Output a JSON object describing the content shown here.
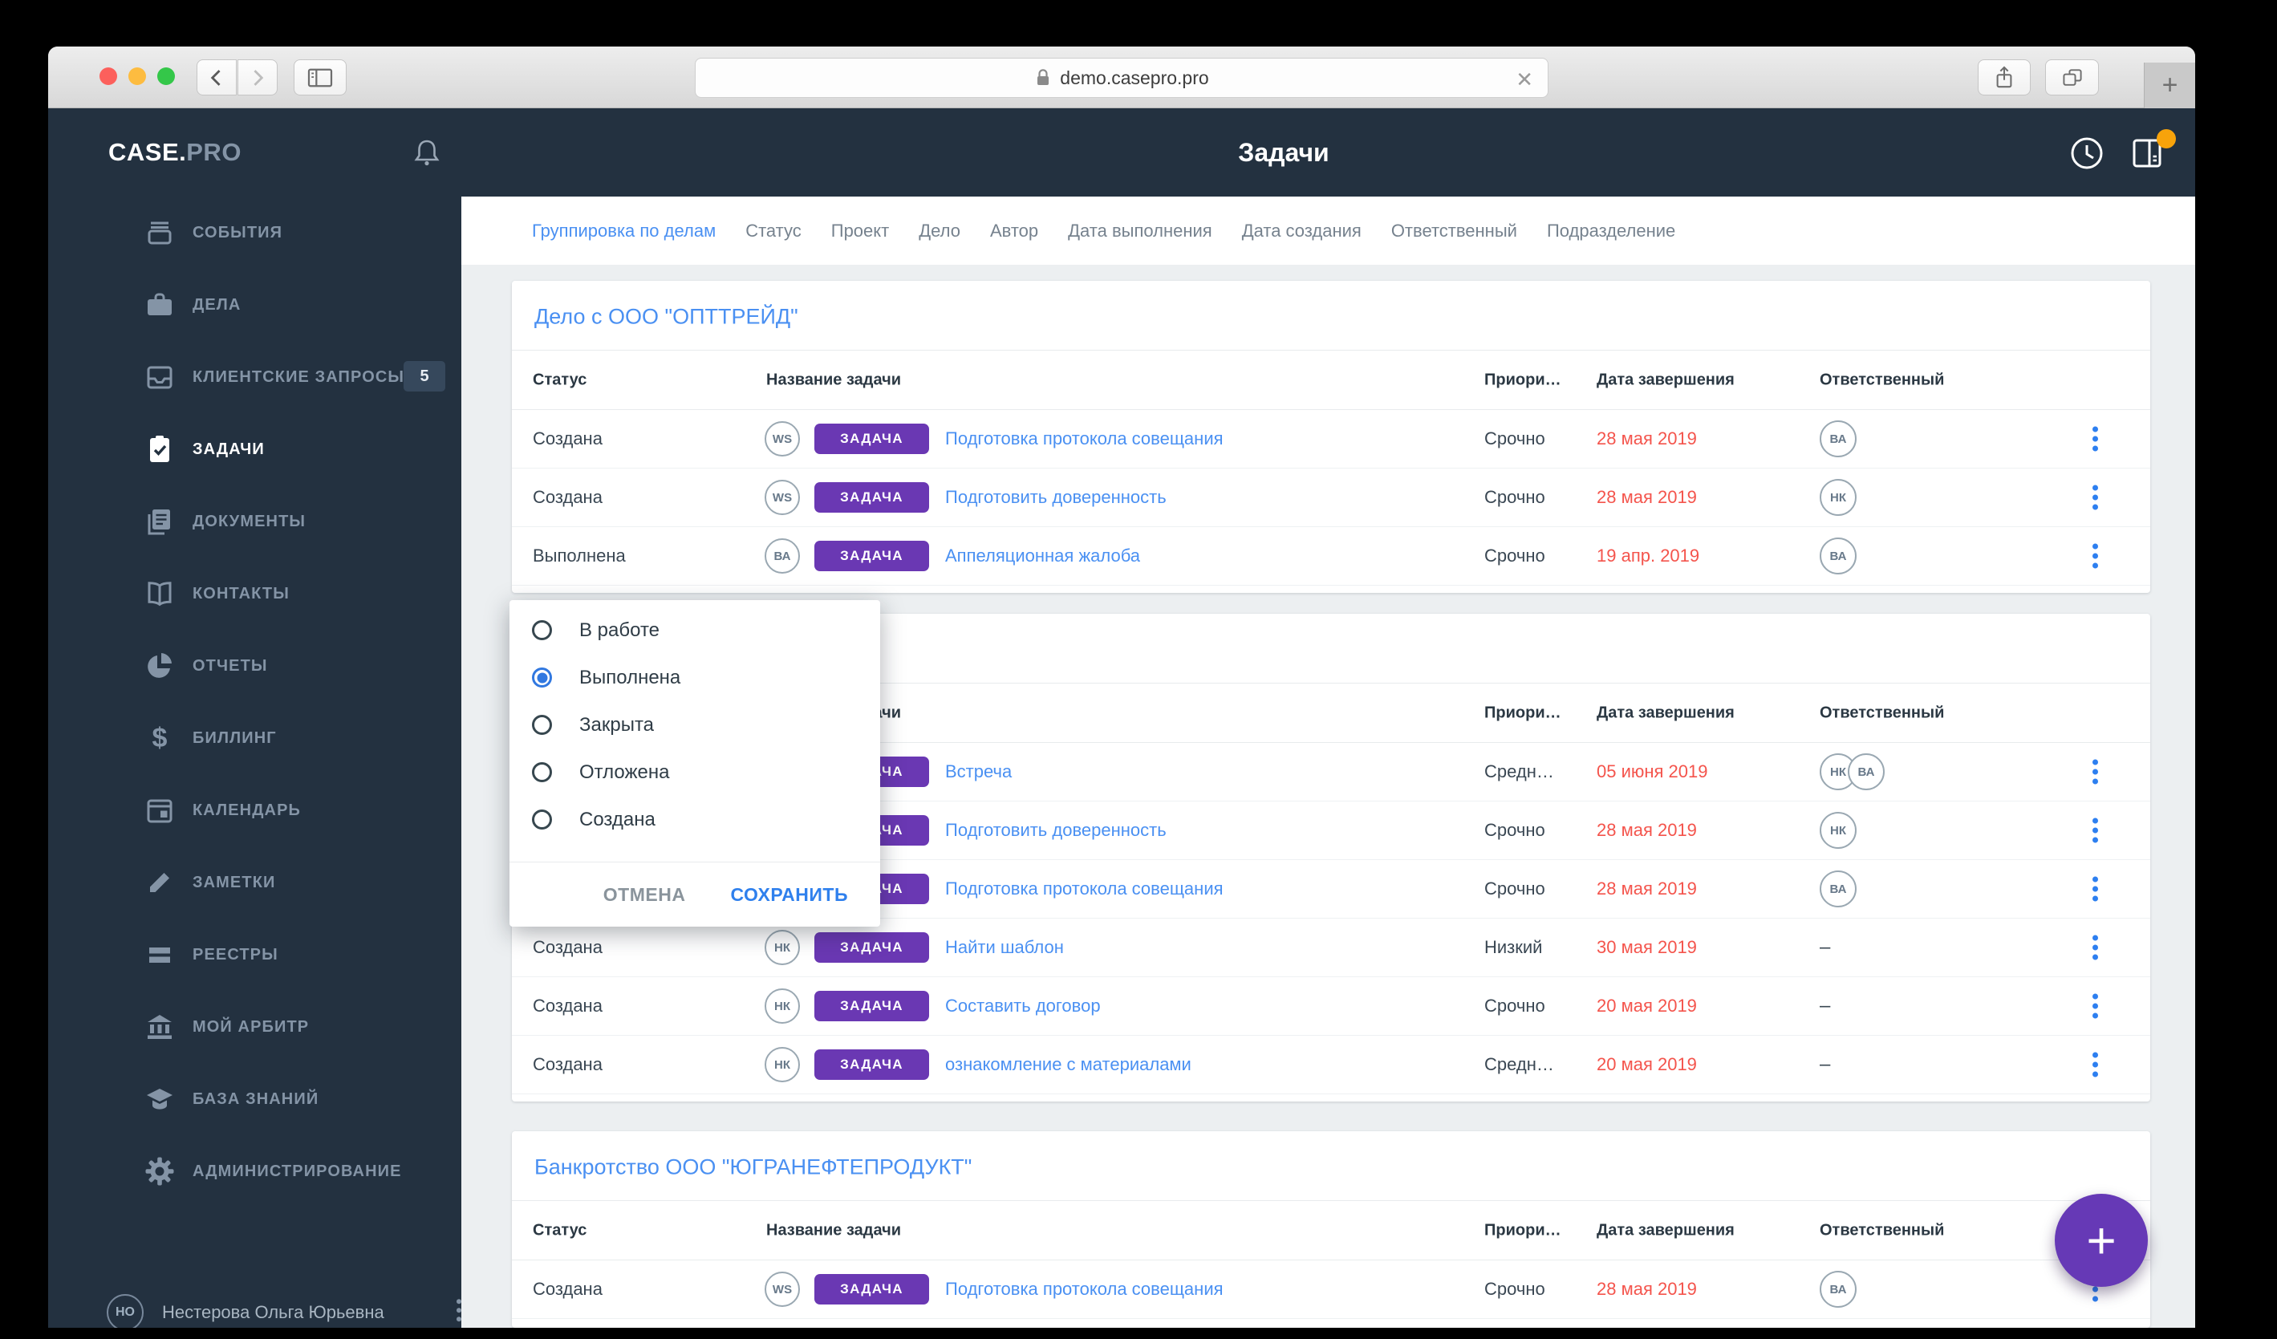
{
  "browser": {
    "url": "demo.casepro.pro",
    "close_x": "✕",
    "new_tab_plus": "+"
  },
  "app": {
    "logo_primary": "CASE.",
    "logo_secondary": "PRO",
    "header_title": "Задачи"
  },
  "sidebar": {
    "items": [
      {
        "label": "СОБЫТИЯ"
      },
      {
        "label": "ДЕЛА"
      },
      {
        "label": "КЛИЕНТСКИЕ ЗАПРОСЫ",
        "badge": "5"
      },
      {
        "label": "ЗАДАЧИ",
        "active": true
      },
      {
        "label": "ДОКУМЕНТЫ"
      },
      {
        "label": "КОНТАКТЫ"
      },
      {
        "label": "ОТЧЕТЫ"
      },
      {
        "label": "БИЛЛИНГ"
      },
      {
        "label": "КАЛЕНДАРЬ"
      },
      {
        "label": "ЗАМЕТКИ"
      },
      {
        "label": "РЕЕСТРЫ"
      },
      {
        "label": "МОЙ АРБИТР"
      },
      {
        "label": "БАЗА ЗНАНИЙ"
      },
      {
        "label": "АДМИНИСТРИРОВАНИЕ"
      }
    ],
    "user": {
      "initials": "НО",
      "name": "Нестерова Ольга Юрьевна"
    }
  },
  "filters": {
    "items": [
      {
        "label": "Группировка по делам",
        "active": true
      },
      {
        "label": "Статус"
      },
      {
        "label": "Проект"
      },
      {
        "label": "Дело"
      },
      {
        "label": "Автор"
      },
      {
        "label": "Дата выполнения"
      },
      {
        "label": "Дата создания"
      },
      {
        "label": "Ответственный"
      },
      {
        "label": "Подразделение"
      }
    ]
  },
  "table": {
    "columns": {
      "status": "Статус",
      "task": "Название задачи",
      "priority": "Приори…",
      "due": "Дата завершения",
      "assignee": "Ответственный"
    },
    "badge_label": "ЗАДАЧА",
    "no_assignee": "–"
  },
  "cards": [
    {
      "title": "Дело с ООО \"ОПТТРЕЙД\"",
      "rows": [
        {
          "status": "Создана",
          "author": "WS",
          "task": "Подготовка протокола совещания",
          "priority": "Срочно",
          "due": "28 мая 2019",
          "assignees": [
            "ВА"
          ]
        },
        {
          "status": "Создана",
          "author": "WS",
          "task": "Подготовить доверенность",
          "priority": "Срочно",
          "due": "28 мая 2019",
          "assignees": [
            "НК"
          ]
        },
        {
          "status": "Выполнена",
          "author": "ВА",
          "task": "Аппеляционная жалоба",
          "priority": "Срочно",
          "due": "19 апр. 2019",
          "assignees": [
            "ВА"
          ]
        }
      ]
    },
    {
      "title": "",
      "rows": [
        {
          "status": "",
          "author": "",
          "task": "Встреча",
          "priority": "Средн…",
          "due": "05 июня 2019",
          "assignees": [
            "НК",
            "ВА"
          ]
        },
        {
          "status": "",
          "author": "",
          "task": "Подготовить доверенность",
          "priority": "Срочно",
          "due": "28 мая 2019",
          "assignees": [
            "НК"
          ]
        },
        {
          "status": "",
          "author": "",
          "task": "Подготовка протокола совещания",
          "priority": "Срочно",
          "due": "28 мая 2019",
          "assignees": [
            "ВА"
          ]
        },
        {
          "status": "Создана",
          "author": "НК",
          "task": "Найти шаблон",
          "priority": "Низкий",
          "due": "30 мая 2019",
          "assignees": []
        },
        {
          "status": "Создана",
          "author": "НК",
          "task": "Составить договор",
          "priority": "Срочно",
          "due": "20 мая 2019",
          "assignees": []
        },
        {
          "status": "Создана",
          "author": "НК",
          "task": "ознакомление с материалами",
          "priority": "Средн…",
          "due": "20 мая 2019",
          "assignees": []
        }
      ]
    },
    {
      "title": "Банкротство ООО \"ЮГРАНЕФТЕПРОДУКТ\"",
      "rows": [
        {
          "status": "Создана",
          "author": "WS",
          "task": "Подготовка протокола совещания",
          "priority": "Срочно",
          "due": "28 мая 2019",
          "assignees": [
            "ВА"
          ]
        }
      ]
    }
  ],
  "popover": {
    "options": [
      {
        "label": "В работе"
      },
      {
        "label": "Выполнена",
        "selected": true
      },
      {
        "label": "Закрыта"
      },
      {
        "label": "Отложена"
      },
      {
        "label": "Создана"
      }
    ],
    "cancel_label": "ОТМЕНА",
    "save_label": "СОХРАНИТЬ"
  },
  "colors": {
    "accent_blue": "#4a90f2",
    "badge_purple": "#6a38b3",
    "fab_purple": "#6639b6",
    "date_red": "#f4544c",
    "dark_shell": "#233140",
    "notification_orange": "#f7a30b"
  }
}
